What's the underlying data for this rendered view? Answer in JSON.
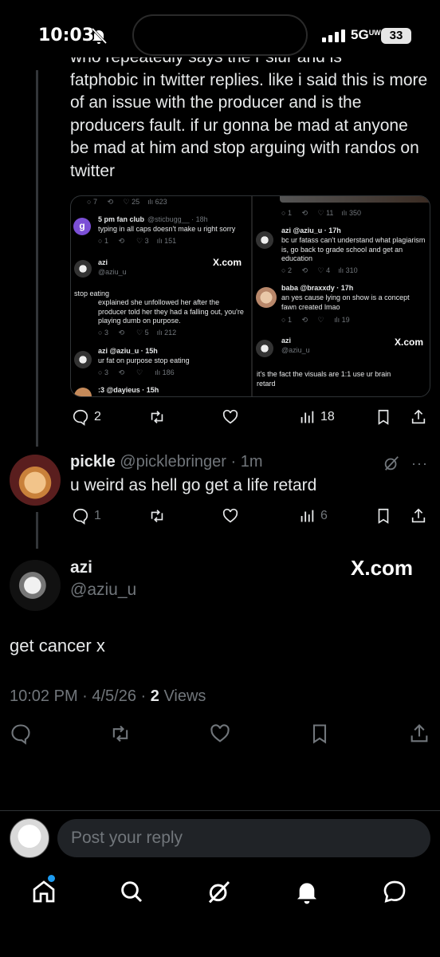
{
  "status_bar": {
    "time": "10:03",
    "network": "5G",
    "network_sup": "UW",
    "battery": "33"
  },
  "tweet1": {
    "cut_line": "who repeatedly says the r slur and is",
    "text": "fatphobic in twitter replies. like i said this is more of an issue with the producer and is the producers fault. if ur gonna be mad at anyone be mad at him and stop arguing with randos on twitter",
    "replies": "2",
    "views": "18"
  },
  "attachment": {
    "left": {
      "top_counts": {
        "replies": "7",
        "likes": "25",
        "views": "623"
      },
      "avatar_letter": "g",
      "fanclub_name": "5 pm fan club",
      "fanclub_handle": "@sticbugg__ · 18h",
      "fanclub_text": "typing in all caps doesn't make u right sorry",
      "fanclub_counts": {
        "replies": "1",
        "likes": "3",
        "views": "151"
      },
      "azi_name": "azi",
      "azi_handle": "@aziu_u",
      "xcom": "X.com",
      "stop_eating": "stop eating",
      "explained": "explained she unfollowed her after the producer told her they had a falling out, you're playing dumb on purpose.",
      "explained_counts": {
        "replies": "3",
        "likes": "5",
        "views": "212"
      },
      "azi2_header": "azi @aziu_u · 15h",
      "azi2_text": "ur fat on purpose stop eating",
      "azi2_counts": {
        "replies": "3",
        "views": "186"
      },
      "dayieus": ":3 @dayieus · 15h"
    },
    "right": {
      "top_counts": {
        "replies": "1",
        "likes": "11",
        "views": "350"
      },
      "azi_header": "azi @aziu_u · 17h",
      "azi_text": "bc ur fatass can't understand what plagiarism is, go back to grade school and get an education",
      "azi_counts": {
        "replies": "2",
        "likes": "4",
        "views": "310"
      },
      "baba_header": "baba @braxxdy · 17h",
      "baba_text": "an yes cause lying on show is a concept fawn created lmao",
      "baba_counts": {
        "replies": "1",
        "views": "19"
      },
      "azi_name": "azi",
      "azi_handle": "@aziu_u",
      "xcom": "X.com",
      "bottom_text": "it's the fact the visuals are 1:1 use ur brain retard"
    }
  },
  "reply": {
    "name": "pickle",
    "handle": "@picklebringer · 1m",
    "text": "u weird as hell go get a life retard",
    "replies": "1",
    "views": "6"
  },
  "main_tweet": {
    "name": "azi",
    "handle": "@aziu_u",
    "xcom": "X.com",
    "text": "get cancer x",
    "time": "10:02 PM · 4/5/26 · ",
    "views_count": "2",
    "views_label": " Views"
  },
  "reply_bar": {
    "placeholder": "Post your reply"
  },
  "colors": {
    "accent": "#1d9bf0",
    "text": "#e7e9ea",
    "muted": "#71767b"
  }
}
